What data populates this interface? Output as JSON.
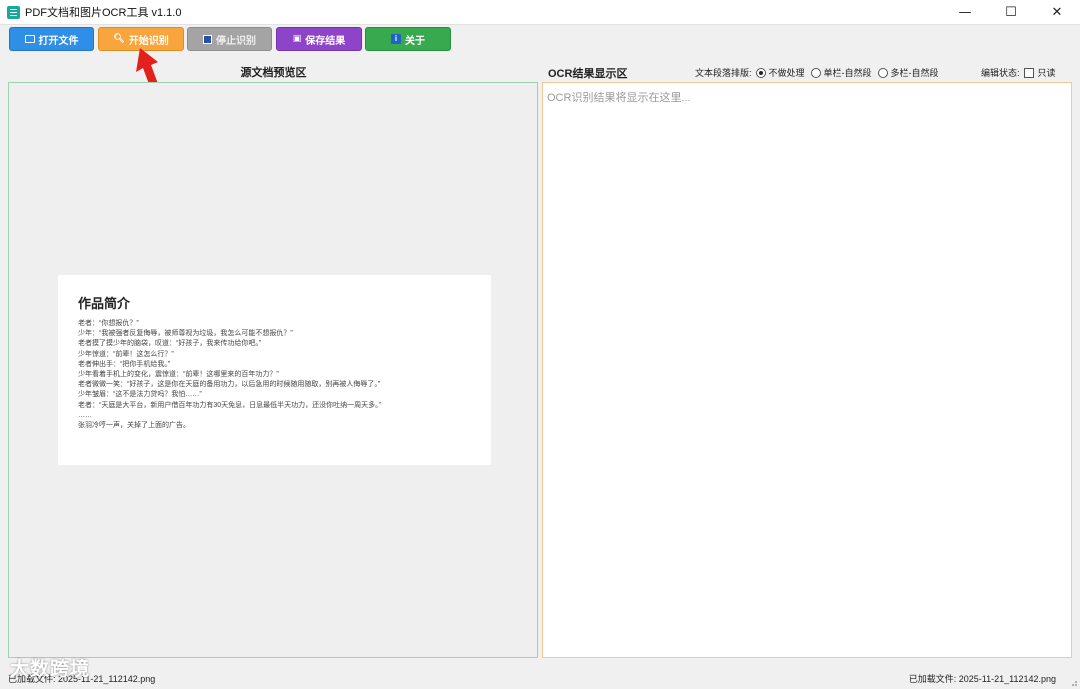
{
  "window": {
    "title": "PDF文档和图片OCR工具 v1.1.0",
    "controls": {
      "minimize": "—",
      "maximize": "☐",
      "close": "✕"
    }
  },
  "toolbar": {
    "open_file": "打开文件",
    "start_ocr": "开始识别",
    "stop_ocr": "停止识别",
    "save_result": "保存结果",
    "about": "关于",
    "colors": {
      "open": "#2f8ee5",
      "start": "#f7a53c",
      "stop": "#a4a4a4",
      "save": "#8e44c9",
      "about": "#38a94f"
    }
  },
  "left_panel": {
    "header": "源文档预览区",
    "document": {
      "title": "作品简介",
      "lines": [
        "老者：“你想报仇？”",
        "少年：“我被强者反复侮辱，被师尊视为垃圾，我怎么可能不想报仇？”",
        "老者摸了摸少年的脑袋，叹道：“好孩子，我来传功给你吧。”",
        "少年惊道：“前辈！这怎么行？”",
        "老者伸出手：“把你手机给我。”",
        "少年看着手机上的变化，震惊道：“前辈！这哪里来的百年功力？”",
        "老者微微一笑：“好孩子，这是你在天庭的备用功力，以后急用的时候随用随取，别再被人侮辱了。”",
        "少年皱眉：“这不是法力贷吗？我怕……”",
        "老者：“天庭是大平台，新用户借百年功力有30天免息，日息最低半天功力，还没你吐纳一周天多。”",
        "……",
        "张羽冷哼一声，关掉了上面的广告。"
      ]
    }
  },
  "right_panel": {
    "header": "OCR结果显示区",
    "layout_label": "文本段落排版:",
    "layout_options": [
      "不做处理",
      "单栏-自然段",
      "多栏-自然段"
    ],
    "layout_selected": "不做处理",
    "edit_state_label": "编辑状态:",
    "readonly_label": "只读",
    "placeholder": "OCR识别结果将显示在这里..."
  },
  "status": {
    "left": "已加载文件: 2025-11-21_112142.png",
    "right": "已加载文件: 2025-11-21_112142.png",
    "watermark": "大数跨境"
  }
}
